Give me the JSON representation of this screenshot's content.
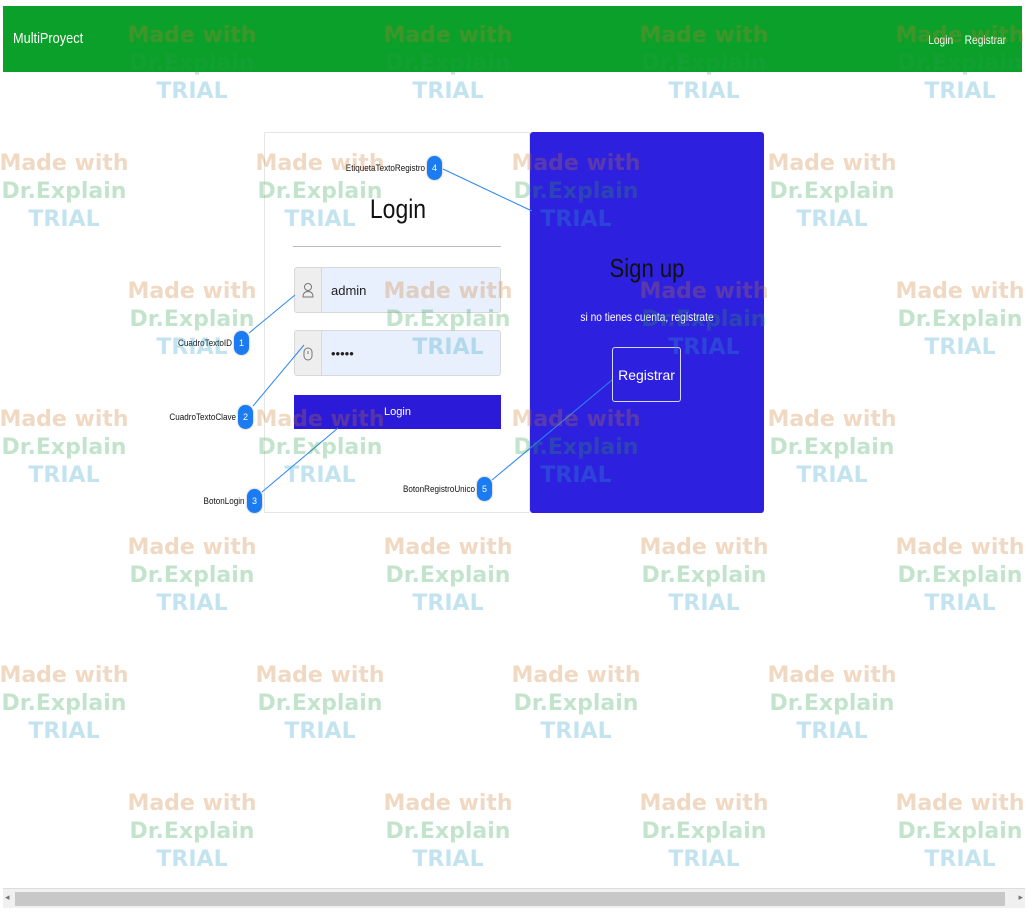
{
  "navbar": {
    "brand": "MultiProyect",
    "links": [
      "Login",
      "Registrar"
    ],
    "color": "#0aa02a"
  },
  "login": {
    "title": "Login",
    "username_value": "admin",
    "password_value": "•••••",
    "button_label": "Login",
    "user_icon": "user-icon",
    "lock_icon": "lock-icon"
  },
  "signup": {
    "title": "Sign up",
    "text": "si no tienes cuenta, registrate",
    "button_label": "Registrar",
    "color": "#2e20df"
  },
  "callouts": [
    {
      "number": "1",
      "label": "CuadroTextoID"
    },
    {
      "number": "2",
      "label": "CuadroTextoClave"
    },
    {
      "number": "3",
      "label": "BotonLogin"
    },
    {
      "number": "4",
      "label": "EtiquetaTextoRegistro"
    },
    {
      "number": "5",
      "label": "BotonRegistroUnico"
    }
  ],
  "watermark": {
    "line1": "Made with",
    "line2": "Dr.Explain",
    "line3": "TRIAL"
  }
}
